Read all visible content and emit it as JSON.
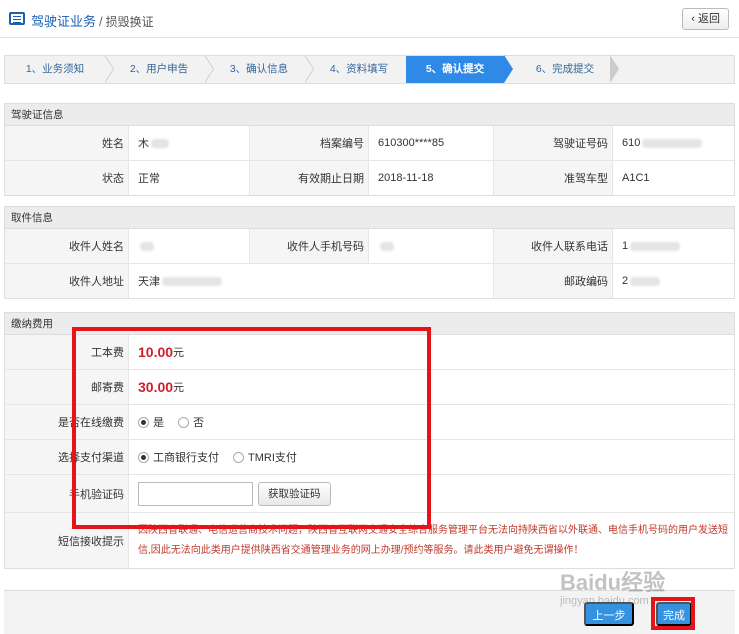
{
  "header": {
    "title": "驾驶证业务",
    "separator": "/",
    "subtitle": "损毁换证",
    "back_label": "‹ 返回",
    "icon": "list-icon"
  },
  "steps": [
    {
      "label": "1、业务须知",
      "active": false
    },
    {
      "label": "2、用户申告",
      "active": false
    },
    {
      "label": "3、确认信息",
      "active": false
    },
    {
      "label": "4、资料填写",
      "active": false
    },
    {
      "label": "5、确认提交",
      "active": true
    },
    {
      "label": "6、完成提交",
      "active": false
    }
  ],
  "license_info": {
    "heading": "驾驶证信息",
    "name_label": "姓名",
    "name_value": "木",
    "file_no_label": "档案编号",
    "file_no_value": "610300****85",
    "license_no_label": "驾驶证号码",
    "license_no_value": "610",
    "status_label": "状态",
    "status_value": "正常",
    "expiry_label": "有效期止日期",
    "expiry_value": "2018-11-18",
    "vehicle_label": "准驾车型",
    "vehicle_value": "A1C1"
  },
  "pickup_info": {
    "heading": "取件信息",
    "recipient_label": "收件人姓名",
    "phone_label": "收件人手机号码",
    "contact_label": "收件人联系电话",
    "contact_value": "1",
    "address_label": "收件人地址",
    "address_value": "天津",
    "postcode_label": "邮政编码",
    "postcode_value": "2"
  },
  "payment": {
    "heading": "缴纳费用",
    "cost_label": "工本费",
    "cost_value": "10.00",
    "cost_unit": "元",
    "postage_label": "邮寄费",
    "postage_value": "30.00",
    "postage_unit": "元",
    "online_label": "是否在线缴费",
    "online_yes": "是",
    "online_no": "否",
    "channel_label": "选择支付渠道",
    "channel_icbc": "工商银行支付",
    "channel_tmri": "TMRI支付",
    "code_label": "手机验证码",
    "code_value": "",
    "code_button": "获取验证码",
    "sms_label": "短信接收提示",
    "sms_notice": "因陕西省联通、电信运营商技术问题，陕西省互联网交通安全综合服务管理平台无法向持陕西省以外联通、电信手机号码的用户发送短信,因此无法向此类用户提供陕西省交通管理业务的网上办理/预约等服务。请此类用户避免无谓操作！"
  },
  "footer": {
    "prev_label": "上一步",
    "finish_label": "完成"
  },
  "watermark": {
    "text": "Baidu经验",
    "sub": "jingyan.baidu.com"
  },
  "colors": {
    "accent": "#2e8ae6",
    "fee": "#d0202e",
    "highlight": "#e5141b"
  }
}
